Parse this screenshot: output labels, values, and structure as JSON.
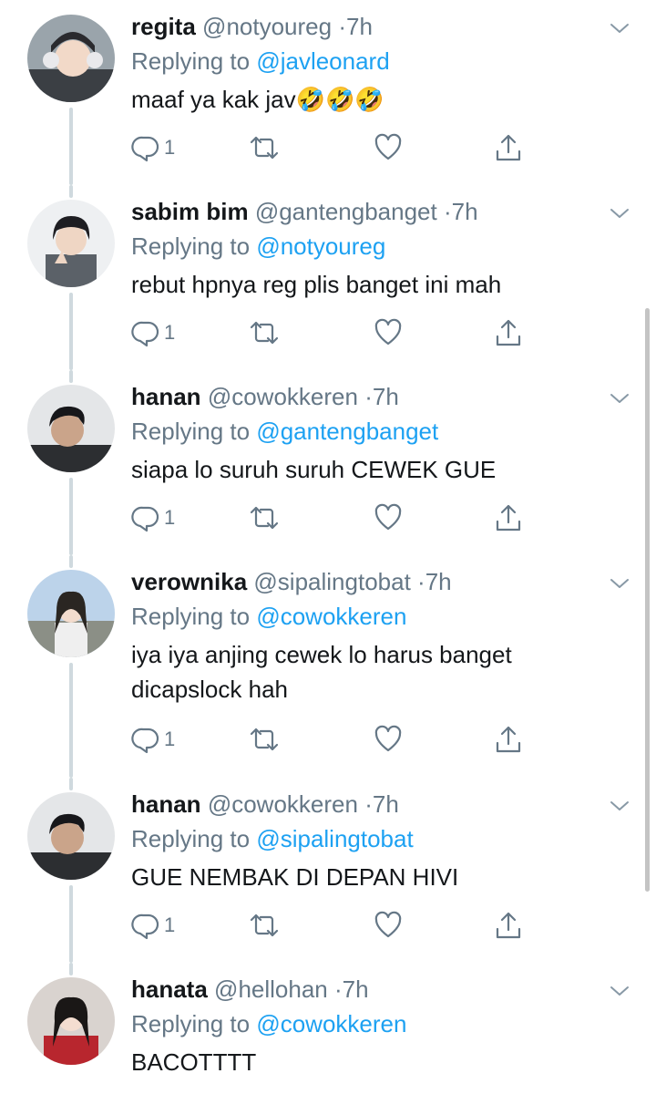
{
  "reply_prefix": "Replying to ",
  "dot": "·",
  "tweets": [
    {
      "name": "regita",
      "handle": "@notyoureg",
      "time": "7h",
      "reply_to": "@javleonard",
      "text": "maaf ya kak jav🤣🤣🤣",
      "reply_count": "1"
    },
    {
      "name": "sabim bim",
      "handle": "@gantengbanget",
      "time": "7h",
      "reply_to": "@notyoureg",
      "text": "rebut hpnya reg plis banget ini mah",
      "reply_count": "1"
    },
    {
      "name": "hanan",
      "handle": "@cowokkeren",
      "time": "7h",
      "reply_to": "@gantengbanget",
      "text": "siapa lo suruh suruh CEWEK GUE",
      "reply_count": "1"
    },
    {
      "name": "verownika",
      "handle": "@sipalingtobat",
      "time": "7h",
      "reply_to": "@cowokkeren",
      "text": "iya iya anjing cewek lo harus banget dicapslock hah",
      "reply_count": "1"
    },
    {
      "name": "hanan",
      "handle": "@cowokkeren",
      "time": "7h",
      "reply_to": "@sipalingtobat",
      "text": "GUE NEMBAK DI DEPAN HIVI",
      "reply_count": "1"
    },
    {
      "name": "hanata",
      "handle": "@hellohan",
      "time": "7h",
      "reply_to": "@cowokkeren",
      "text": "BACOTTTT",
      "reply_count": ""
    }
  ],
  "icons": {
    "reply": "reply-icon",
    "retweet": "retweet-icon",
    "like": "heart-icon",
    "share": "share-icon",
    "more": "chevron-down-icon"
  },
  "colors": {
    "link": "#1da1f2",
    "secondary": "#657786",
    "thread_line": "#cfd9de"
  }
}
